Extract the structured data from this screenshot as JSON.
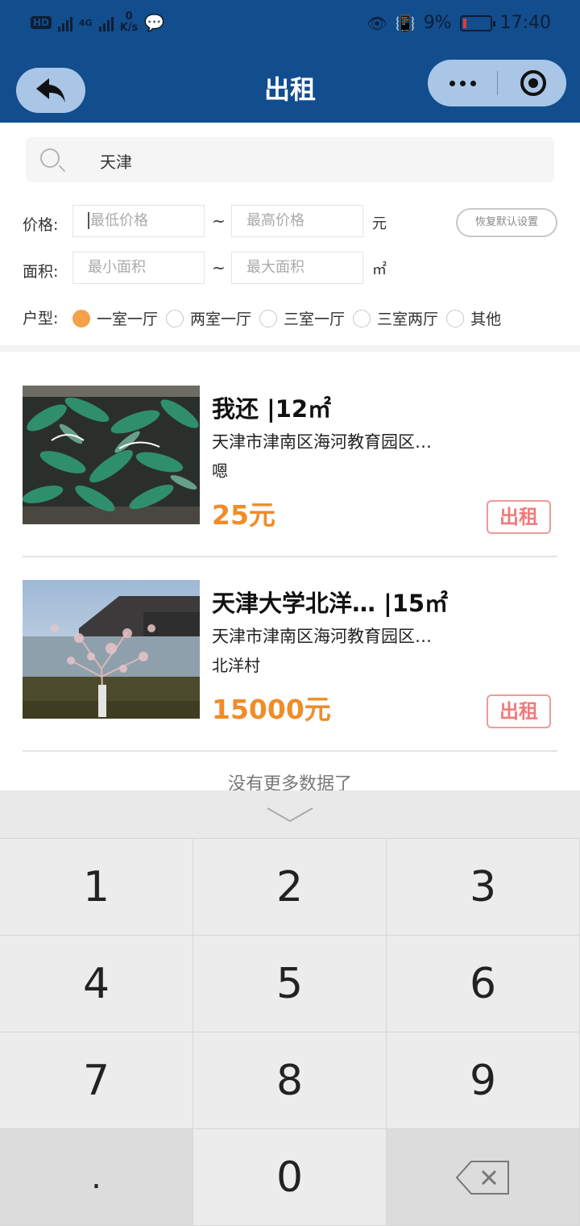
{
  "status_bar": {
    "hd": "HD",
    "net_speed_value": "0",
    "net_speed_unit": "K/s",
    "network_type": "4G",
    "battery_percent": "9%",
    "time": "17:40"
  },
  "header": {
    "title": "出租",
    "back_icon": "back-arrow-icon",
    "more_icon": "more-dots-icon",
    "close_icon": "target-icon"
  },
  "search": {
    "value": "天津"
  },
  "filters": {
    "price_label": "价格:",
    "price_min_placeholder": "最低价格",
    "price_max_placeholder": "最高价格",
    "price_unit": "元",
    "area_label": "面积:",
    "area_min_placeholder": "最小面积",
    "area_max_placeholder": "最大面积",
    "area_unit": "㎡",
    "range_sep": "~",
    "reset_label": "恢复默认设置",
    "layout_label": "户型:",
    "layouts": [
      {
        "label": "一室一厅",
        "selected": true
      },
      {
        "label": "两室一厅",
        "selected": false
      },
      {
        "label": "三室一厅",
        "selected": false
      },
      {
        "label": "三室两厅",
        "selected": false
      },
      {
        "label": "其他",
        "selected": false
      }
    ]
  },
  "listings": [
    {
      "title": "我还 |12㎡",
      "address": "天津市津南区海河教育园区…",
      "note": "嗯",
      "price": "25元",
      "tag": "出租"
    },
    {
      "title": "天津大学北洋…    |15㎡",
      "address": "天津市津南区海河教育园区…",
      "note": "北洋村",
      "price": "15000元",
      "tag": "出租"
    }
  ],
  "no_more": "没有更多数据了",
  "keyboard": {
    "keys": [
      "1",
      "2",
      "3",
      "4",
      "5",
      "6",
      "7",
      "8",
      "9",
      ".",
      "0"
    ],
    "collapse_icon": "chevron-down-icon",
    "delete_icon": "backspace-icon"
  },
  "colors": {
    "header_bg": "#124d8e",
    "price": "#f08c2a",
    "tag": "#ee7b7b",
    "radio_selected": "#f5a04a"
  }
}
